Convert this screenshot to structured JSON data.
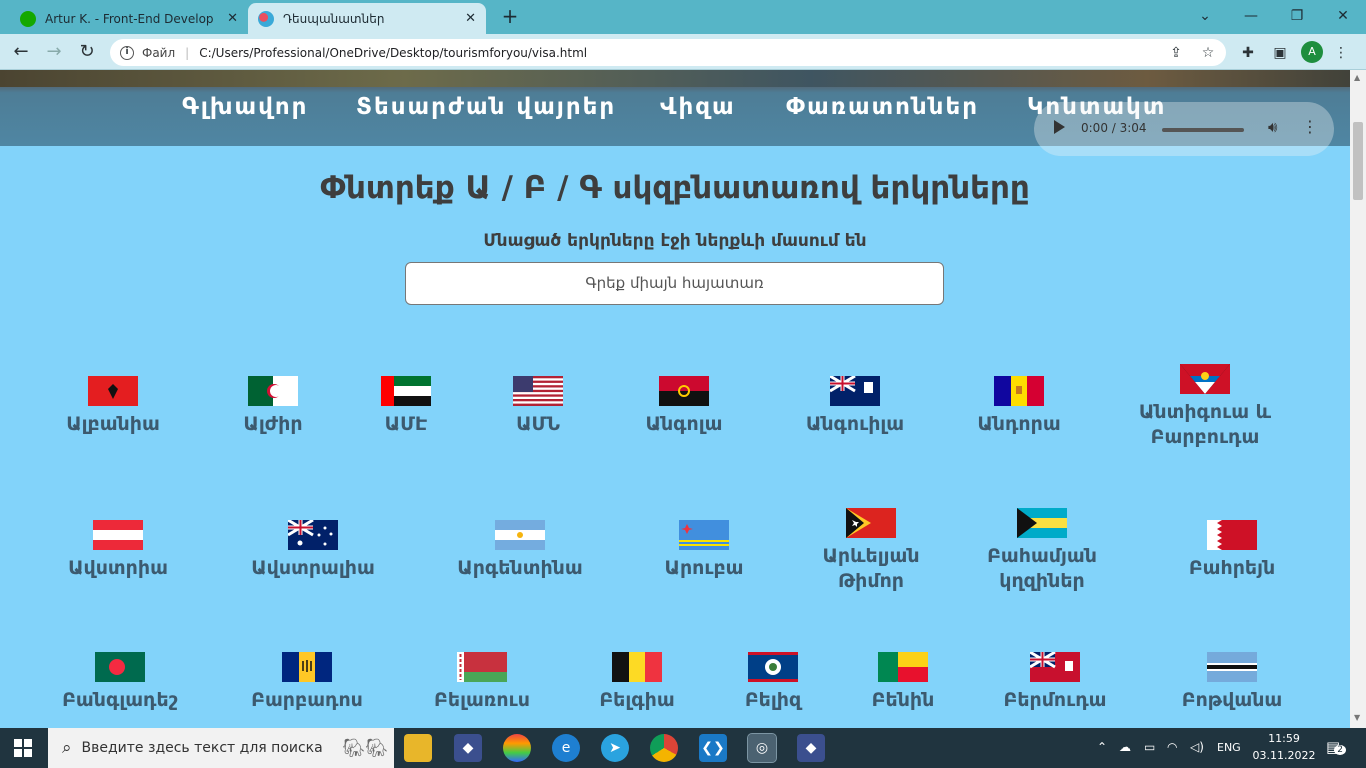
{
  "browser": {
    "tabs": [
      {
        "title": "Artur K. - Front-End Developer - Upwork",
        "active": false
      },
      {
        "title": "Դեսպանատներ",
        "active": true
      }
    ],
    "new_tab": "+",
    "window_controls": {
      "minimize": "—",
      "restore": "❐",
      "close": "✕",
      "tab_list": "⌄"
    },
    "address": {
      "scheme": "Файл",
      "separator": "|",
      "url": "C:/Users/Professional/OneDrive/Desktop/tourismforyou/visa.html"
    },
    "profile_initial": "A"
  },
  "page": {
    "nav": [
      "Գլխավոր",
      "Տեսարժան վայրեր",
      "Վիզա",
      "Փառատոններ",
      "Կոնտակտ"
    ],
    "audio": {
      "time": "0:00 / 3:04"
    },
    "heading": "Փնտրեք Ա / Բ / Գ սկզբնատառով երկրները",
    "subheading": "Մնացած երկրները էջի ներքևի մասում են",
    "search_placeholder": "Գրեք միայն հայատառ",
    "countries": [
      [
        "Ալբանիա"
      ],
      [
        "Ալժիր"
      ],
      [
        "ԱՄԷ"
      ],
      [
        "ԱՄՆ"
      ],
      [
        "Անգոլա"
      ],
      [
        "Անգուիլա"
      ],
      [
        "Անդորա"
      ],
      [
        "Անտիգուա և",
        "Բարբուդա"
      ],
      [
        "Ավստրիա"
      ],
      [
        "Ավստրալիա"
      ],
      [
        "Արգենտինա"
      ],
      [
        "Արուբա"
      ],
      [
        "Արևելյան",
        "Թիմոր"
      ],
      [
        "Բահամյան",
        "կղզիներ"
      ],
      [
        "Բահրեյն"
      ],
      [
        "Բանգլադեշ"
      ],
      [
        "Բարբադոս"
      ],
      [
        "Բելառուս"
      ],
      [
        "Բելգիա"
      ],
      [
        "Բելիզ"
      ],
      [
        "Բենին"
      ],
      [
        "Բերմուդա"
      ],
      [
        "Բոթվանա"
      ]
    ]
  },
  "taskbar": {
    "search_placeholder": "Введите здесь текст для поиска",
    "language": "ENG",
    "time": "11:59",
    "date": "03.11.2022",
    "notifications": "2"
  }
}
